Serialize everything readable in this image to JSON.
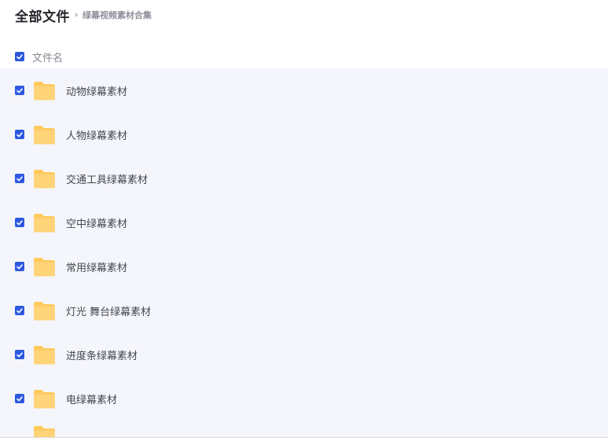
{
  "breadcrumb": {
    "root": "全部文件",
    "current": "绿幕视频素材合集"
  },
  "list_header": {
    "column_label": "文件名",
    "select_all_checked": true
  },
  "files": [
    {
      "name": "动物绿幕素材",
      "checked": true,
      "icon": "folder-icon"
    },
    {
      "name": "人物绿幕素材",
      "checked": true,
      "icon": "folder-icon"
    },
    {
      "name": "交通工具绿幕素材",
      "checked": true,
      "icon": "folder-icon"
    },
    {
      "name": "空中绿幕素材",
      "checked": true,
      "icon": "folder-icon"
    },
    {
      "name": "常用绿幕素材",
      "checked": true,
      "icon": "folder-icon"
    },
    {
      "name": "灯光 舞台绿幕素材",
      "checked": true,
      "icon": "folder-icon"
    },
    {
      "name": "进度条绿幕素材",
      "checked": true,
      "icon": "folder-icon"
    },
    {
      "name": "电绿幕素材",
      "checked": true,
      "icon": "folder-icon"
    }
  ],
  "colors": {
    "checkbox_accent": "#2d59e0",
    "folder": "#ffc95c",
    "list_background": "#f5f6fc"
  }
}
